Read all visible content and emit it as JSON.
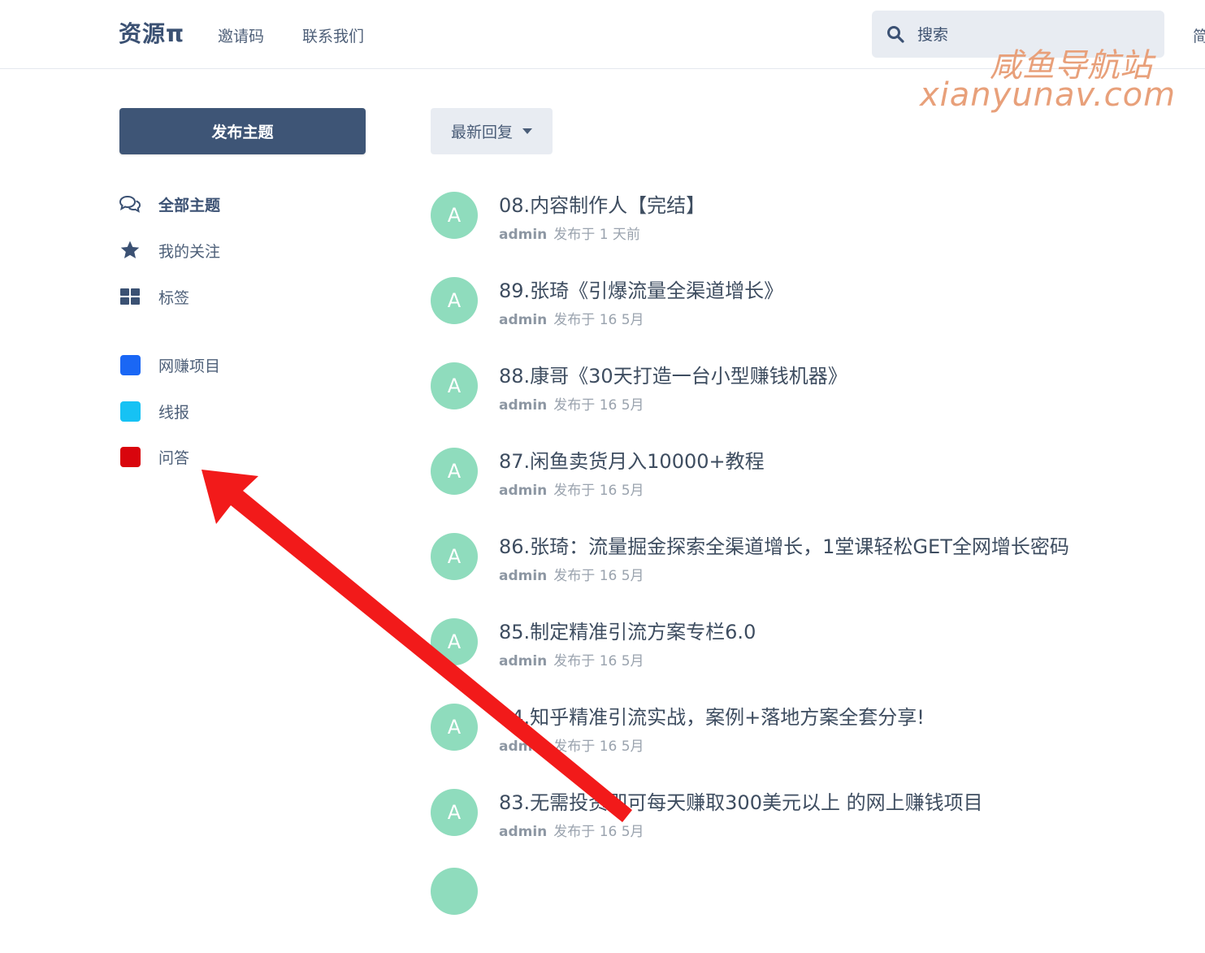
{
  "header": {
    "logo": "资源π",
    "nav": [
      "邀请码",
      "联系我们"
    ],
    "search": {
      "placeholder": "搜索"
    },
    "overflow_label": "简"
  },
  "watermark": {
    "cn": "咸鱼导航站",
    "en": "xianyunav.com"
  },
  "sidebar": {
    "publish_label": "发布主题",
    "items": [
      {
        "label": "全部主题",
        "icon": "chat-bubbles-icon",
        "active": true
      },
      {
        "label": "我的关注",
        "icon": "star-icon"
      },
      {
        "label": "标签",
        "icon": "grid-icon"
      }
    ],
    "tags": [
      {
        "label": "网赚项目",
        "color": "#1a67f5"
      },
      {
        "label": "线报",
        "color": "#16c2f4"
      },
      {
        "label": "问答",
        "color": "#d9050d"
      }
    ]
  },
  "main": {
    "sort_label": "最新回复",
    "threads": [
      {
        "avatar": "A",
        "title": "08.内容制作人【完结】",
        "author": "admin",
        "meta": "发布于 1 天前"
      },
      {
        "avatar": "A",
        "title": "89.张琦《引爆流量全渠道增长》",
        "author": "admin",
        "meta": "发布于 16 5月"
      },
      {
        "avatar": "A",
        "title": "88.康哥《30天打造一台小型赚钱机器》",
        "author": "admin",
        "meta": "发布于 16 5月"
      },
      {
        "avatar": "A",
        "title": "87.闲鱼卖货月入10000+教程",
        "author": "admin",
        "meta": "发布于 16 5月"
      },
      {
        "avatar": "A",
        "title": "86.张琦：流量掘金探索全渠道增长，1堂课轻松GET全网增长密码",
        "author": "admin",
        "meta": "发布于 16 5月"
      },
      {
        "avatar": "A",
        "title": "85.制定精准引流方案专栏6.0",
        "author": "admin",
        "meta": "发布于 16 5月"
      },
      {
        "avatar": "A",
        "title": "84.知乎精准引流实战，案例+落地方案全套分享!",
        "author": "admin",
        "meta": "发布于 16 5月"
      },
      {
        "avatar": "A",
        "title": "83.无需投资即可每天赚取300美元以上 的网上赚钱项目",
        "author": "admin",
        "meta": "发布于 16 5月"
      }
    ]
  },
  "colors": {
    "accent": "#3e5576",
    "avatar": "#8fdcbd",
    "arrow": "#f21a1a"
  }
}
